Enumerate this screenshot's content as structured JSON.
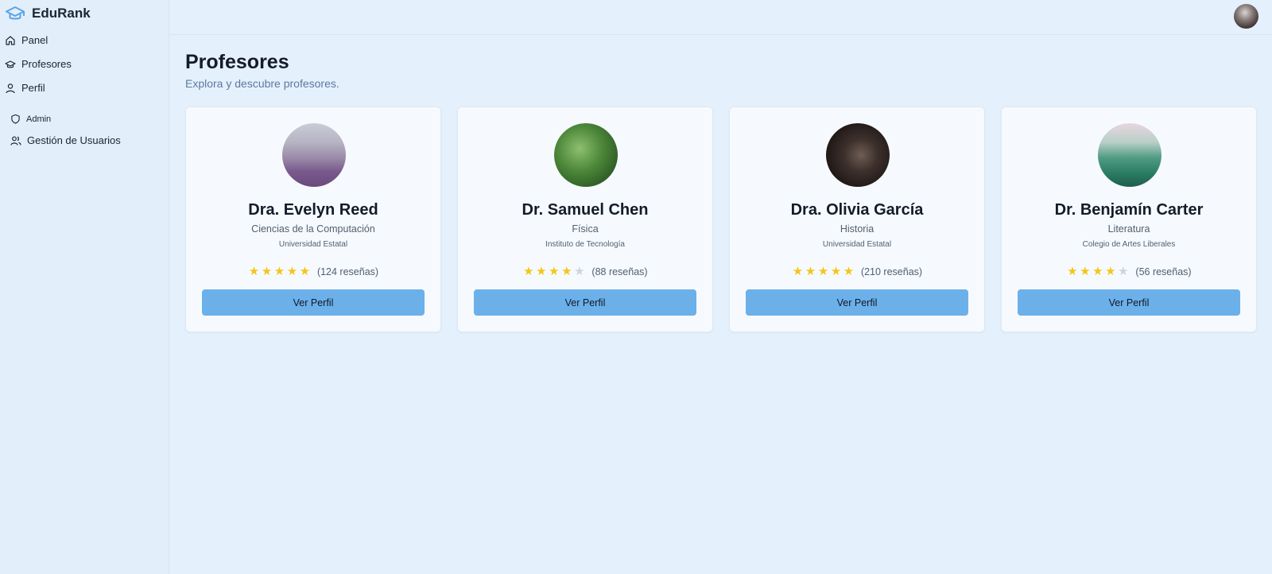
{
  "app": {
    "name": "EduRank"
  },
  "sidebar": {
    "items": [
      {
        "label": "Panel",
        "icon": "home-icon"
      },
      {
        "label": "Profesores",
        "icon": "graduation-cap-icon"
      },
      {
        "label": "Perfil",
        "icon": "user-icon"
      }
    ],
    "admin": {
      "section_label": "Admin",
      "items": [
        {
          "label": "Gestión de Usuarios",
          "icon": "users-icon"
        }
      ]
    }
  },
  "page": {
    "title": "Profesores",
    "subtitle": "Explora y descubre profesores."
  },
  "professors": [
    {
      "name": "Dra. Evelyn Reed",
      "department": "Ciencias de la Computación",
      "institution": "Universidad Estatal",
      "rating": 5,
      "reviews": "(124 reseñas)",
      "button": "Ver Perfil"
    },
    {
      "name": "Dr. Samuel Chen",
      "department": "Física",
      "institution": "Instituto de Tecnología",
      "rating": 4,
      "reviews": "(88 reseñas)",
      "button": "Ver Perfil"
    },
    {
      "name": "Dra. Olivia García",
      "department": "Historia",
      "institution": "Universidad Estatal",
      "rating": 5,
      "reviews": "(210 reseñas)",
      "button": "Ver Perfil"
    },
    {
      "name": "Dr. Benjamín Carter",
      "department": "Literatura",
      "institution": "Colegio de Artes Liberales",
      "rating": 4,
      "reviews": "(56 reseñas)",
      "button": "Ver Perfil"
    }
  ],
  "colors": {
    "accent": "#6cb0ea",
    "star_filled": "#f5c518",
    "star_empty": "#ccd4dc",
    "background": "#e4f0fb"
  }
}
